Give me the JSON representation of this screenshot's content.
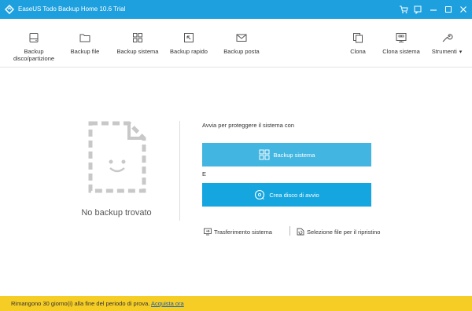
{
  "window": {
    "title": "EaseUS Todo Backup Home 10.6 Trial",
    "controls": [
      "cart-icon",
      "feedback-icon",
      "minimize-icon",
      "maximize-icon",
      "close-icon"
    ]
  },
  "toolbar": {
    "left": [
      {
        "icon": "disk-icon",
        "label_1": "Backup",
        "label_2": "disco/partizione"
      },
      {
        "icon": "folder-icon",
        "label_1": "Backup file"
      },
      {
        "icon": "windows-icon",
        "label_1": "Backup sistema"
      },
      {
        "icon": "cursor-icon",
        "label_1": "Backup rapido"
      },
      {
        "icon": "mail-icon",
        "label_1": "Backup posta"
      }
    ],
    "right": [
      {
        "icon": "clone-icon",
        "label_1": "Clona"
      },
      {
        "icon": "system-clone-icon",
        "label_1": "Clona sistema"
      },
      {
        "icon": "wrench-icon",
        "label_1": "Strumenti",
        "caret": "▾"
      }
    ]
  },
  "main": {
    "empty_label": "No backup trovato",
    "protect_title": "Avvia per proteggere il sistema con",
    "backup_system_button": "Backup sistema",
    "or_text": "E",
    "create_disk_button": "Crea disco di avvio",
    "transfer_link": "Trasferimento sistema",
    "restore_link": "Selezione file per il ripristino"
  },
  "statusbar": {
    "message": "Rimangono 30 giorno(i) alla fine del periodo di prova.",
    "buy_link": "Acquista ora"
  },
  "colors": {
    "titlebar": "#1fa0de",
    "button_backup": "#42b6e0",
    "button_disk": "#16a6df",
    "statusbar": "#f6cd25"
  }
}
